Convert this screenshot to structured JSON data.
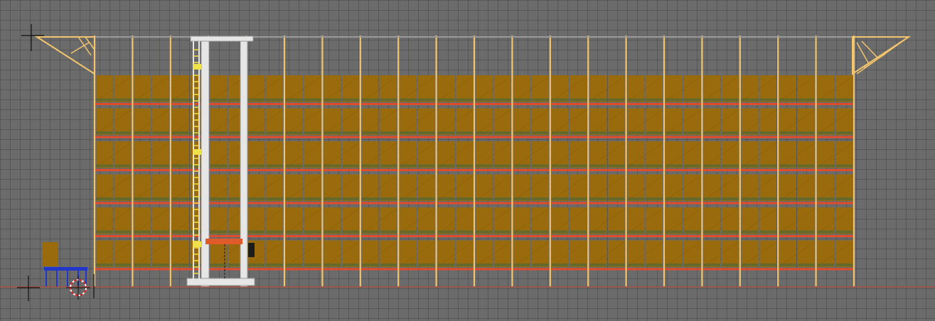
{
  "viewport": {
    "background_color": "#6b6b6b",
    "grid_color": "#5a5a5a"
  },
  "colors": {
    "upright": "#f2c46d",
    "beam": "#e04b2a",
    "pallet": "#9a6b0c",
    "pallet_dark": "#7c5408",
    "crane_frame": "#e6e6e6",
    "crane_ladder": "#f0e24a",
    "crane_carriage": "#e05a2a",
    "conveyor": "#2236c8",
    "floor_line": "#b04a3a",
    "cursor": "#ffffff",
    "origin_cross": "#1a1a1a"
  },
  "icons": {
    "origin_marker": "crosshair-icon",
    "3d_cursor": "3d-cursor-icon"
  },
  "rack": {
    "bays": 20,
    "levels": 6
  }
}
